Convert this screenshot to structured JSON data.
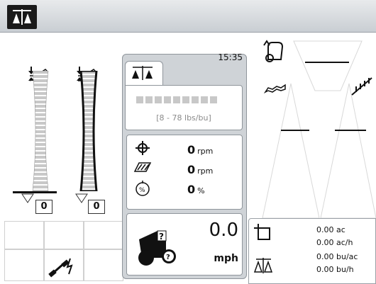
{
  "header": {
    "icon": "grain-yield-icon"
  },
  "sensors": {
    "left": {
      "value": "0",
      "icon": "header-height-icon"
    },
    "right": {
      "value": "0",
      "icon": "header-height-flat-icon"
    }
  },
  "card": {
    "time": "15:35",
    "range_label": "[8 - 78 lbs/bu]",
    "rows": [
      {
        "icon": "thresher-icon",
        "value": "0",
        "unit": "rpm"
      },
      {
        "icon": "rotor-icon",
        "value": "0",
        "unit": "rpm"
      },
      {
        "icon": "loss-icon",
        "value": "0",
        "unit": "%"
      }
    ],
    "speed": {
      "value": "0.0",
      "unit": "mph"
    }
  },
  "stats": {
    "area": "0.00 ac",
    "area_rate": "0.00 ac/h",
    "yield": "0.00 bu/ac",
    "yield_rate": "0.00 bu/h"
  },
  "colors": {
    "dark": "#111111",
    "panel": "#cfd3d7",
    "accent": "#c8c8c8"
  }
}
